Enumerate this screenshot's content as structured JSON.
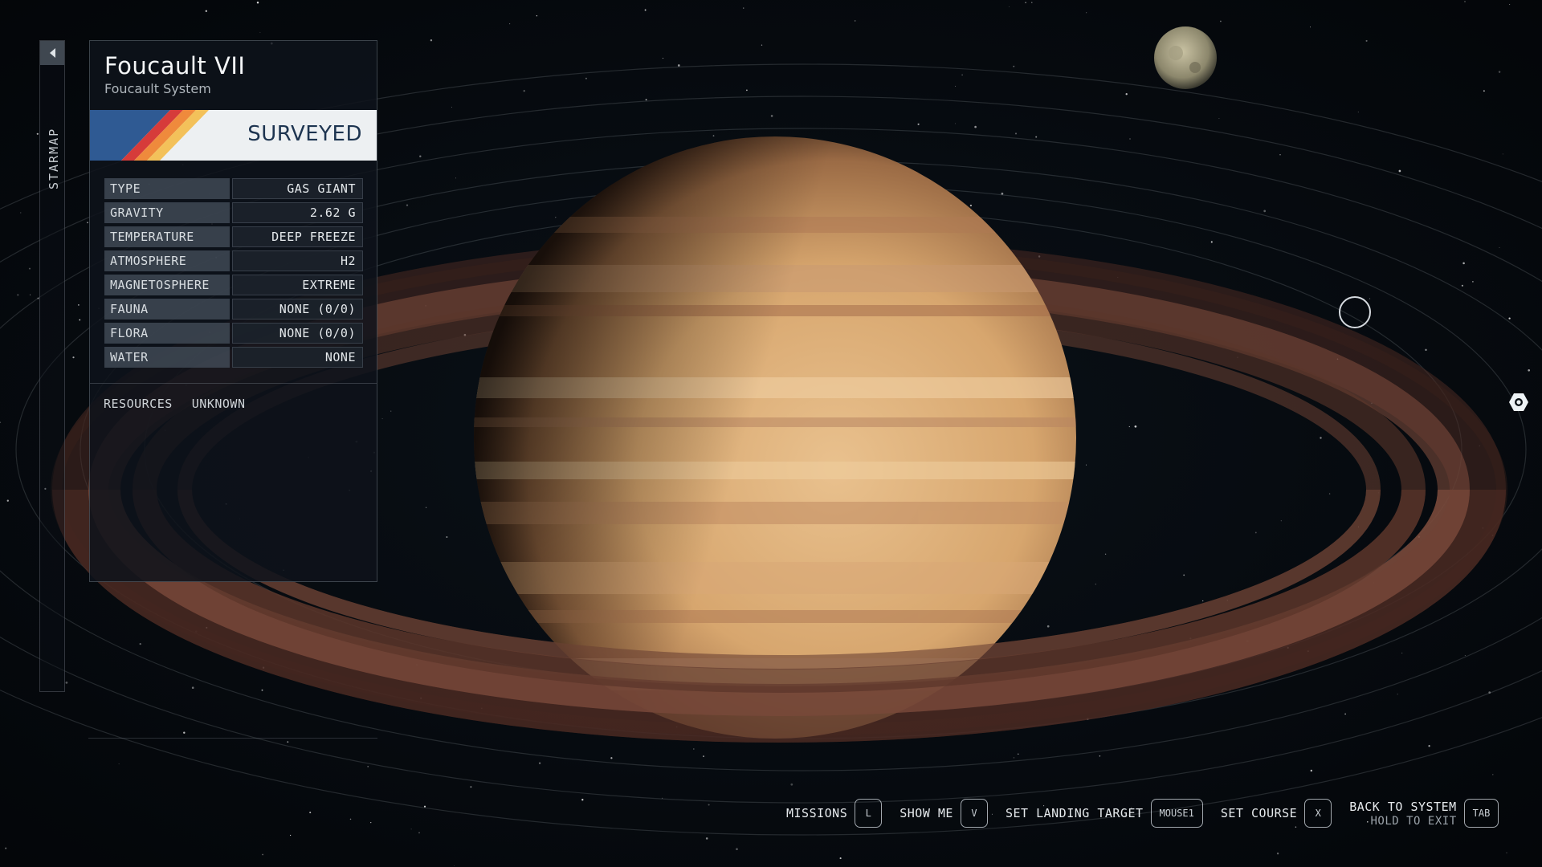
{
  "sidebar": {
    "label": "STARMAP",
    "back_icon": "chevron-left-icon"
  },
  "planet": {
    "name": "Foucault VII",
    "system": "Foucault System",
    "status": "SURVEYED",
    "stats": [
      {
        "label": "TYPE",
        "value": "GAS GIANT"
      },
      {
        "label": "GRAVITY",
        "value": "2.62 G"
      },
      {
        "label": "TEMPERATURE",
        "value": "DEEP FREEZE"
      },
      {
        "label": "ATMOSPHERE",
        "value": "H2"
      },
      {
        "label": "MAGNETOSPHERE",
        "value": "EXTREME"
      },
      {
        "label": "FAUNA",
        "value": "NONE (0/0)"
      },
      {
        "label": "FLORA",
        "value": "NONE (0/0)"
      },
      {
        "label": "WATER",
        "value": "NONE"
      }
    ],
    "resources_label": "RESOURCES",
    "resources_value": "UNKNOWN"
  },
  "hints": {
    "missions": {
      "label": "MISSIONS",
      "key": "L"
    },
    "show_me": {
      "label": "SHOW ME",
      "key": "V"
    },
    "landing": {
      "label": "SET LANDING TARGET",
      "key": "MOUSE1"
    },
    "course": {
      "label": "SET COURSE",
      "key": "X"
    },
    "back": {
      "label": "BACK TO SYSTEM",
      "sub": "HOLD TO EXIT",
      "key": "TAB"
    }
  },
  "colors": {
    "survey_band": "#edf0f2",
    "survey_text": "#1d3450",
    "stripe_blue": "#2f5a93",
    "stripe_red": "#d63b3a",
    "stripe_orange": "#ef8a3c",
    "stripe_yellow": "#f3c15a"
  }
}
